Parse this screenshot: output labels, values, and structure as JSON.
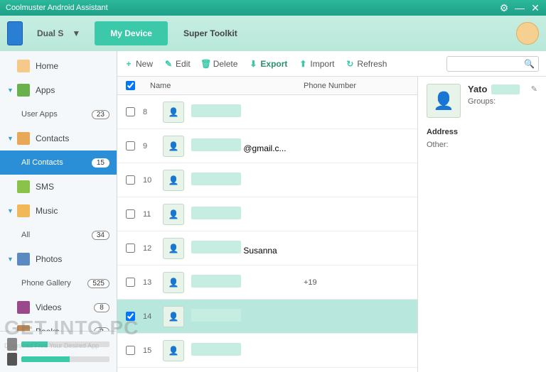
{
  "titlebar": {
    "title": "Coolmuster Android Assistant"
  },
  "header": {
    "device": "Dual S",
    "tabs": {
      "mydevice": "My Device",
      "supertoolkit": "Super Toolkit"
    }
  },
  "sidebar": {
    "items": [
      {
        "label": "Home",
        "icon": "home"
      },
      {
        "label": "Apps",
        "icon": "apps",
        "expandable": true
      },
      {
        "label": "User Apps",
        "sub": true,
        "badge": "23"
      },
      {
        "label": "Contacts",
        "icon": "contacts",
        "expandable": true
      },
      {
        "label": "All Contacts",
        "sub": true,
        "badge": "15",
        "active": true
      },
      {
        "label": "SMS",
        "icon": "sms"
      },
      {
        "label": "Music",
        "icon": "music",
        "expandable": true
      },
      {
        "label": "All",
        "sub": true,
        "badge": "34"
      },
      {
        "label": "Photos",
        "icon": "photos",
        "expandable": true
      },
      {
        "label": "Phone Gallery",
        "sub": true,
        "badge": "525"
      },
      {
        "label": "Videos",
        "icon": "videos",
        "badge": "8"
      },
      {
        "label": "Books",
        "icon": "books",
        "badge": "3"
      }
    ],
    "storage": [
      {
        "pct": 30
      },
      {
        "pct": 55
      }
    ]
  },
  "toolbar": {
    "new": "New",
    "edit": "Edit",
    "delete": "Delete",
    "export": "Export",
    "import": "Import",
    "refresh": "Refresh"
  },
  "columns": {
    "name": "Name",
    "phone": "Phone Number"
  },
  "rows": [
    {
      "idx": "8",
      "name": "",
      "phone": "",
      "checked": false
    },
    {
      "idx": "9",
      "name": "@gmail.c...",
      "phone": "",
      "checked": false
    },
    {
      "idx": "10",
      "name": "",
      "phone": "",
      "checked": false
    },
    {
      "idx": "11",
      "name": "",
      "phone": "",
      "checked": false
    },
    {
      "idx": "12",
      "name": "Susanna",
      "phone": "",
      "checked": false
    },
    {
      "idx": "13",
      "name": "",
      "phone": "+19",
      "checked": false
    },
    {
      "idx": "14",
      "name": "",
      "phone": "",
      "checked": true,
      "selected": true
    },
    {
      "idx": "15",
      "name": "",
      "phone": "",
      "checked": false
    }
  ],
  "detail": {
    "name": "Yato",
    "groups_label": "Groups:",
    "address_label": "Address",
    "other_label": "Other:"
  },
  "watermark": {
    "main": "GET INTO PC",
    "sub": "Download Free Your Desired App"
  }
}
